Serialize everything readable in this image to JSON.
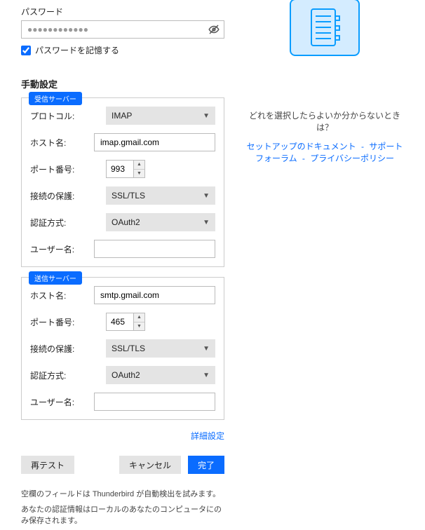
{
  "password": {
    "label": "パスワード",
    "value": "●●●●●●●●●●●●",
    "remember_label": "パスワードを記憶する"
  },
  "manual_title": "手動設定",
  "incoming": {
    "badge": "受信サーバー",
    "protocol_label": "プロトコル:",
    "protocol_value": "IMAP",
    "host_label": "ホスト名:",
    "host_value": "imap.gmail.com",
    "port_label": "ポート番号:",
    "port_value": "993",
    "security_label": "接続の保護:",
    "security_value": "SSL/TLS",
    "auth_label": "認証方式:",
    "auth_value": "OAuth2",
    "user_label": "ユーザー名:",
    "user_value": ""
  },
  "outgoing": {
    "badge": "送信サーバー",
    "host_label": "ホスト名:",
    "host_value": "smtp.gmail.com",
    "port_label": "ポート番号:",
    "port_value": "465",
    "security_label": "接続の保護:",
    "security_value": "SSL/TLS",
    "auth_label": "認証方式:",
    "auth_value": "OAuth2",
    "user_label": "ユーザー名:",
    "user_value": ""
  },
  "adv_link": "詳細設定",
  "buttons": {
    "retest": "再テスト",
    "cancel": "キャンセル",
    "done": "完了"
  },
  "footer": {
    "line1": "空欄のフィールドは Thunderbird が自動検出を試みます。",
    "line2": "あなたの認証情報はローカルのあなたのコンピュータにのみ保存されます。"
  },
  "help": {
    "question": "どれを選択したらよいか分からないときは？",
    "link1": "セットアップのドキュメント",
    "link2": "サポートフォーラム",
    "link3": "プライバシーポリシー",
    "sep": " - "
  }
}
